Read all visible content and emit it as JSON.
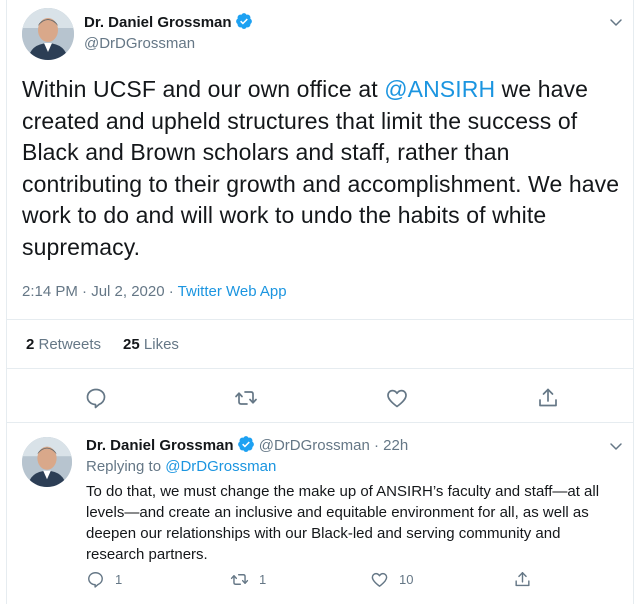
{
  "main_tweet": {
    "author_name": "Dr. Daniel Grossman",
    "author_handle": "@DrDGrossman",
    "text_before": "Within UCSF and our own office at ",
    "mention": "@ANSIRH",
    "text_after": " we have created and upheld structures that limit the success of Black and Brown scholars and staff, rather than contributing to their growth and accomplishment. We have work to do and will work to undo the habits of white supremacy.",
    "timestamp": "2:14 PM · Jul 2, 2020",
    "separator": " · ",
    "source": "Twitter Web App",
    "retweets_count": "2",
    "retweets_label": " Retweets",
    "likes_count": "25",
    "likes_label": " Likes"
  },
  "reply_tweet": {
    "author_name": "Dr. Daniel Grossman",
    "author_handle": "@DrDGrossman",
    "time": " · 22h",
    "replying_label": "Replying to ",
    "replying_to": "@DrDGrossman",
    "text": "To do that, we must change the make up of ANSIRH’s faculty and staff—at all levels—and create an inclusive and equitable environment for all, as well as deepen our relationships with our Black-led and serving community and research partners.",
    "reply_count": "1",
    "retweet_count": "1",
    "like_count": "10"
  },
  "icons": {
    "verified": "verified-badge-icon",
    "more": "chevron-down-icon",
    "reply": "reply-icon",
    "retweet": "retweet-icon",
    "like": "heart-icon",
    "share": "share-icon"
  },
  "colors": {
    "text": "#14171a",
    "secondary": "#657786",
    "link": "#1b95e0",
    "verified": "#1da1f2",
    "border": "#e6ecf0"
  }
}
